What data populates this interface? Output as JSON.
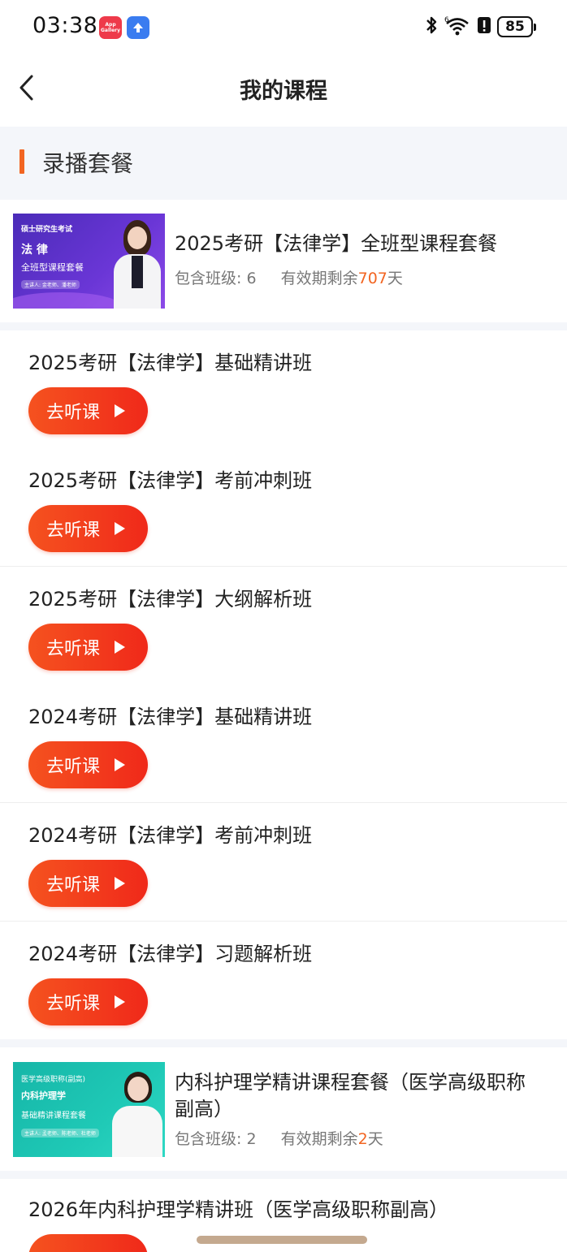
{
  "status_bar": {
    "time": "03:38",
    "gallery_badge": "App Gallery",
    "battery": "85",
    "icons": [
      "app-gallery-icon",
      "upload-icon",
      "bluetooth-icon",
      "wifi-icon",
      "alert-icon",
      "battery-icon"
    ]
  },
  "nav": {
    "title": "我的课程"
  },
  "section": {
    "title": "录播套餐"
  },
  "packages": [
    {
      "title": "2025考研【法律学】全班型课程套餐",
      "classes_label": "包含班级:",
      "classes_count": "6",
      "validity_prefix": "有效期剩余",
      "validity_days": "707",
      "validity_suffix": "天",
      "thumb": {
        "line1": "硕士研究生考试",
        "line2": "法 律",
        "line3": "全班型课程套餐",
        "line4": "主讲人: 金老师、潘老师"
      }
    },
    {
      "title": "内科护理学精讲课程套餐（医学高级职称副高）",
      "classes_label": "包含班级:",
      "classes_count": "2",
      "validity_prefix": "有效期剩余",
      "validity_days": "2",
      "validity_suffix": "天",
      "thumb": {
        "line1": "医学高级职称(副高)",
        "line2": "内科护理学",
        "line3": "基础精讲课程套餐",
        "line4": "主讲人: 孟老师、陈老师、杜老师"
      }
    }
  ],
  "courses": [
    {
      "title": "2025考研【法律学】基础精讲班",
      "button": "去听课"
    },
    {
      "title": "2025考研【法律学】考前冲刺班",
      "button": "去听课"
    },
    {
      "title": "2025考研【法律学】大纲解析班",
      "button": "去听课"
    },
    {
      "title": "2024考研【法律学】基础精讲班",
      "button": "去听课"
    },
    {
      "title": "2024考研【法律学】考前冲刺班",
      "button": "去听课"
    },
    {
      "title": "2024考研【法律学】习题解析班",
      "button": "去听课"
    }
  ],
  "next_course": {
    "title": "2026年内科护理学精讲班（医学高级职称副高）"
  },
  "colors": {
    "accent": "#f26522",
    "button_start": "#f5521f",
    "button_end": "#f0291a",
    "section_bg": "#f4f6fa"
  }
}
